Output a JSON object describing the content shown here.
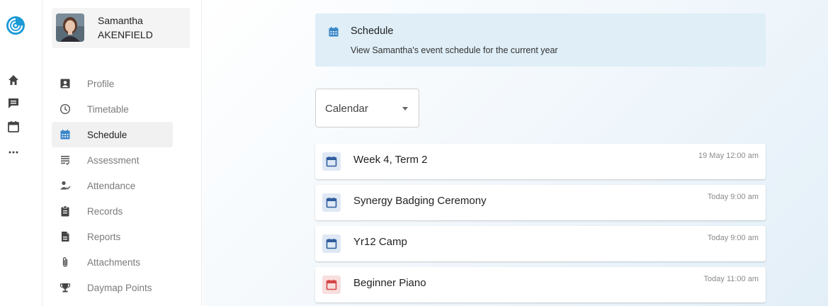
{
  "rail": {
    "logo_icon": "daymap-logo-icon",
    "icons": [
      "home-icon",
      "chat-icon",
      "calendar-icon",
      "more-icon"
    ],
    "accent": "#1b9ad6"
  },
  "profile": {
    "first_name": "Samantha",
    "last_name": "AKENFIELD"
  },
  "nav": {
    "items": [
      {
        "label": "Profile",
        "icon": "profile-card-icon",
        "active": false
      },
      {
        "label": "Timetable",
        "icon": "clock-icon",
        "active": false
      },
      {
        "label": "Schedule",
        "icon": "calendar-icon",
        "active": true
      },
      {
        "label": "Assessment",
        "icon": "assessment-list-icon",
        "active": false
      },
      {
        "label": "Attendance",
        "icon": "attendance-person-icon",
        "active": false
      },
      {
        "label": "Records",
        "icon": "clipboard-icon",
        "active": false
      },
      {
        "label": "Reports",
        "icon": "document-icon",
        "active": false
      },
      {
        "label": "Attachments",
        "icon": "paperclip-icon",
        "active": false
      },
      {
        "label": "Daymap Points",
        "icon": "trophy-icon",
        "active": false
      }
    ]
  },
  "banner": {
    "title": "Schedule",
    "subtitle": "View Samantha's event schedule for the current year",
    "icon": "calendar-icon"
  },
  "view_select": {
    "value": "Calendar"
  },
  "events": [
    {
      "title": "Week 4, Term 2",
      "time": "19 May 12:00 am",
      "color": "#2f5d9c"
    },
    {
      "title": "Synergy Badging Ceremony",
      "time": "Today 9:00 am",
      "color": "#2f5d9c"
    },
    {
      "title": "Yr12 Camp",
      "time": "Today 9:00 am",
      "color": "#2f5d9c"
    },
    {
      "title": "Beginner Piano",
      "time": "Today 11:00 am",
      "color": "#d64545"
    }
  ]
}
